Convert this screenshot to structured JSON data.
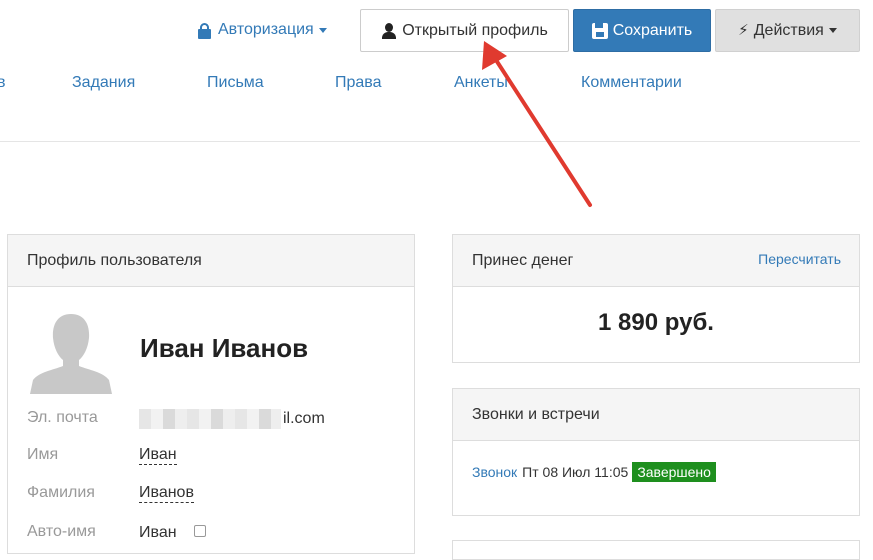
{
  "toolbar": {
    "auth_label": "Авторизация",
    "open_profile_label": "Открытый профиль",
    "save_label": "Сохранить",
    "actions_label": "Действия"
  },
  "nav": {
    "cut_item": "в",
    "items": [
      "Задания",
      "Письма",
      "Права",
      "Анкеты",
      "Комментарии"
    ]
  },
  "profile_panel": {
    "title": "Профиль пользователя",
    "name": "Иван Иванов",
    "fields": {
      "email_label": "Эл. почта",
      "email_value": "il.com",
      "first_name_label": "Имя",
      "first_name_value": "Иван",
      "last_name_label": "Фамилия",
      "last_name_value": "Иванов",
      "auto_name_label": "Авто-имя",
      "auto_name_value": "Иван"
    }
  },
  "money_panel": {
    "title": "Принес денег",
    "recalc_label": "Пересчитать",
    "value": "1 890 руб."
  },
  "calls_panel": {
    "title": "Звонки и встречи",
    "call_link": "Звонок",
    "call_datetime": "Пт 08 Июл 11:05",
    "call_status": "Завершено"
  },
  "colors": {
    "accent": "#337ab7",
    "status_done": "#1e8f1e",
    "annotation_arrow": "#e03a2f"
  }
}
